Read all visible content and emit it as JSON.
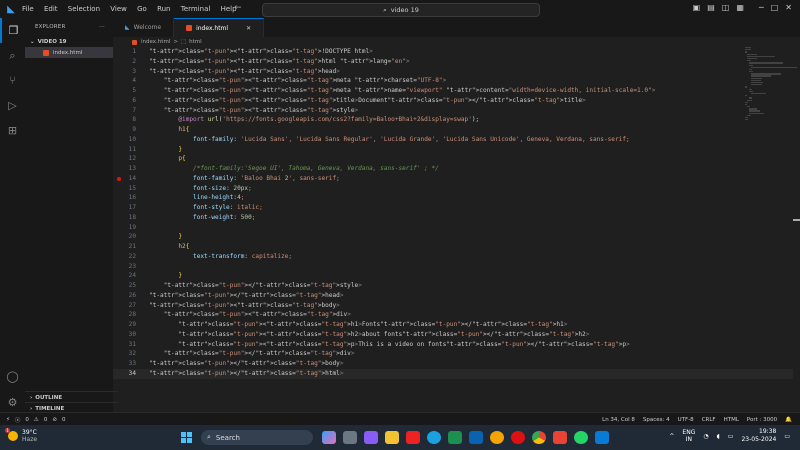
{
  "titlebar": {
    "menu": [
      "File",
      "Edit",
      "Selection",
      "View",
      "Go",
      "Run",
      "Terminal",
      "Help"
    ],
    "search": "video 19"
  },
  "sidebar": {
    "header": "EXPLORER",
    "folder": "VIDEO 19",
    "file": "index.html",
    "outline": "OUTLINE",
    "timeline": "TIMELINE"
  },
  "tabs": [
    {
      "label": "Welcome",
      "active": false
    },
    {
      "label": "index.html",
      "active": true
    }
  ],
  "breadcrumb": {
    "file": "index.html",
    "sep": ">",
    "node": "html"
  },
  "editor": {
    "current_line": 34,
    "breakpoint_line": 14,
    "lines": [
      "<!DOCTYPE html>",
      "<html lang=\"en\">",
      "<head>",
      "    <meta charset=\"UTF-8\">",
      "    <meta name=\"viewport\" content=\"width=device-width, initial-scale=1.0\">",
      "    <title>Document</title>",
      "    <style>",
      "        @import url('https://fonts.googleapis.com/css2?family=Baloo+Bhai+2&display=swap');",
      "        h1{",
      "            font-family: 'Lucida Sans', 'Lucida Sans Regular', 'Lucida Grande', 'Lucida Sans Unicode', Geneva, Verdana, sans-serif;",
      "        }",
      "        p{",
      "            /*font-family:'Segoe UI', Tahoma, Geneva, Verdana, sans-serif' ; */",
      "            font-family: 'Baloo Bhai 2', sans-serif;",
      "            font-size: 20px;",
      "            line-height:4;",
      "            font-style: italic;",
      "            font-weight: 500;",
      "",
      "        }",
      "        h2{",
      "            text-transform: capitalize;",
      "",
      "        }",
      "    </style>",
      "</head>",
      "<body>",
      "    <div>",
      "        <h1>Fonts</h1>",
      "        <h2>about fonts</h2>",
      "        <p>This is a video on fonts</p>",
      "    </div>",
      "</body>",
      "</html>"
    ]
  },
  "statusbar": {
    "errors": "0",
    "warnings": "0",
    "ports": "0",
    "position": "Ln 34, Col 8",
    "spaces": "Spaces: 4",
    "encoding": "UTF-8",
    "eol": "CRLF",
    "language": "HTML",
    "port": "Port : 3000"
  },
  "taskbar": {
    "weather_temp": "39°C",
    "weather_desc": "Haze",
    "search_placeholder": "Search",
    "lang1": "ENG",
    "lang2": "IN",
    "time": "19:38",
    "date": "23-05-2024"
  }
}
